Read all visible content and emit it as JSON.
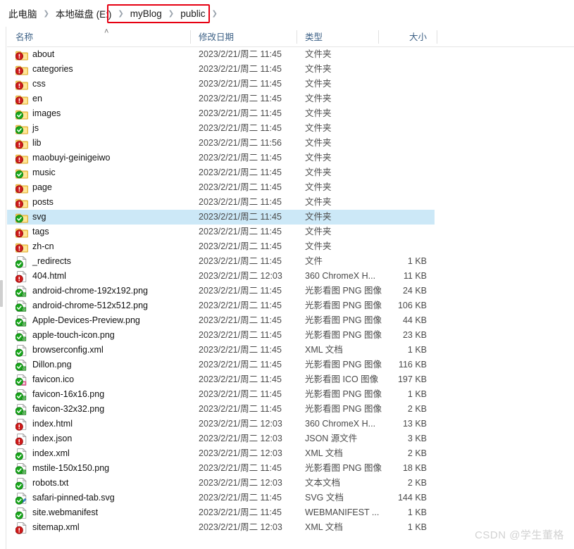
{
  "window": {
    "title": "public"
  },
  "breadcrumb": {
    "separator": "❯",
    "items": [
      {
        "label": "此电脑",
        "highlighted": false
      },
      {
        "label": "本地磁盘 (E:)",
        "highlighted": false
      },
      {
        "label": "myBlog",
        "highlighted": true
      },
      {
        "label": "public",
        "highlighted": true
      }
    ],
    "annotation_color": "#e60012"
  },
  "columns": {
    "name": "名称",
    "date": "修改日期",
    "type": "类型",
    "size": "大小",
    "sort_indicator": "˄",
    "sort_column": "名称",
    "sort_direction": "ascending"
  },
  "selection": {
    "selected_row_name": "svg",
    "highlight_color": "#cce8f7"
  },
  "rows": [
    {
      "name": "about",
      "date": "2023/2/21/周二 11:45",
      "type": "文件夹",
      "size": "",
      "icon": "folder-alert-icon",
      "selected": false
    },
    {
      "name": "categories",
      "date": "2023/2/21/周二 11:45",
      "type": "文件夹",
      "size": "",
      "icon": "folder-alert-icon",
      "selected": false
    },
    {
      "name": "css",
      "date": "2023/2/21/周二 11:45",
      "type": "文件夹",
      "size": "",
      "icon": "folder-alert-icon",
      "selected": false
    },
    {
      "name": "en",
      "date": "2023/2/21/周二 11:45",
      "type": "文件夹",
      "size": "",
      "icon": "folder-alert-icon",
      "selected": false
    },
    {
      "name": "images",
      "date": "2023/2/21/周二 11:45",
      "type": "文件夹",
      "size": "",
      "icon": "folder-synced-icon",
      "selected": false
    },
    {
      "name": "js",
      "date": "2023/2/21/周二 11:45",
      "type": "文件夹",
      "size": "",
      "icon": "folder-synced-icon",
      "selected": false
    },
    {
      "name": "lib",
      "date": "2023/2/21/周二 11:56",
      "type": "文件夹",
      "size": "",
      "icon": "folder-alert-icon",
      "selected": false
    },
    {
      "name": "maobuyi-geinigeiwo",
      "date": "2023/2/21/周二 11:45",
      "type": "文件夹",
      "size": "",
      "icon": "folder-alert-icon",
      "selected": false
    },
    {
      "name": "music",
      "date": "2023/2/21/周二 11:45",
      "type": "文件夹",
      "size": "",
      "icon": "folder-synced-icon",
      "selected": false
    },
    {
      "name": "page",
      "date": "2023/2/21/周二 11:45",
      "type": "文件夹",
      "size": "",
      "icon": "folder-alert-icon",
      "selected": false
    },
    {
      "name": "posts",
      "date": "2023/2/21/周二 11:45",
      "type": "文件夹",
      "size": "",
      "icon": "folder-alert-icon",
      "selected": false
    },
    {
      "name": "svg",
      "date": "2023/2/21/周二 11:45",
      "type": "文件夹",
      "size": "",
      "icon": "folder-synced-icon",
      "selected": true
    },
    {
      "name": "tags",
      "date": "2023/2/21/周二 11:45",
      "type": "文件夹",
      "size": "",
      "icon": "folder-alert-icon",
      "selected": false
    },
    {
      "name": "zh-cn",
      "date": "2023/2/21/周二 11:45",
      "type": "文件夹",
      "size": "",
      "icon": "folder-alert-icon",
      "selected": false
    },
    {
      "name": "_redirects",
      "date": "2023/2/21/周二 11:45",
      "type": "文件",
      "size": "1 KB",
      "icon": "file-synced-icon",
      "selected": false
    },
    {
      "name": "404.html",
      "date": "2023/2/21/周二 12:03",
      "type": "360 ChromeX H...",
      "size": "11 KB",
      "icon": "file-alert-icon",
      "selected": false
    },
    {
      "name": "android-chrome-192x192.png",
      "date": "2023/2/21/周二 11:45",
      "type": "光影看图 PNG 图像",
      "size": "24 KB",
      "icon": "file-png-icon",
      "selected": false
    },
    {
      "name": "android-chrome-512x512.png",
      "date": "2023/2/21/周二 11:45",
      "type": "光影看图 PNG 图像",
      "size": "106 KB",
      "icon": "file-png-icon",
      "selected": false
    },
    {
      "name": "Apple-Devices-Preview.png",
      "date": "2023/2/21/周二 11:45",
      "type": "光影看图 PNG 图像",
      "size": "44 KB",
      "icon": "file-png-icon",
      "selected": false
    },
    {
      "name": "apple-touch-icon.png",
      "date": "2023/2/21/周二 11:45",
      "type": "光影看图 PNG 图像",
      "size": "23 KB",
      "icon": "file-png-icon",
      "selected": false
    },
    {
      "name": "browserconfig.xml",
      "date": "2023/2/21/周二 11:45",
      "type": "XML 文档",
      "size": "1 KB",
      "icon": "file-synced-icon",
      "selected": false
    },
    {
      "name": "Dillon.png",
      "date": "2023/2/21/周二 11:45",
      "type": "光影看图 PNG 图像",
      "size": "116 KB",
      "icon": "file-png-icon",
      "selected": false
    },
    {
      "name": "favicon.ico",
      "date": "2023/2/21/周二 11:45",
      "type": "光影看图 ICO 图像",
      "size": "197 KB",
      "icon": "file-ico-icon",
      "selected": false
    },
    {
      "name": "favicon-16x16.png",
      "date": "2023/2/21/周二 11:45",
      "type": "光影看图 PNG 图像",
      "size": "1 KB",
      "icon": "file-png-icon",
      "selected": false
    },
    {
      "name": "favicon-32x32.png",
      "date": "2023/2/21/周二 11:45",
      "type": "光影看图 PNG 图像",
      "size": "2 KB",
      "icon": "file-png-icon",
      "selected": false
    },
    {
      "name": "index.html",
      "date": "2023/2/21/周二 12:03",
      "type": "360 ChromeX H...",
      "size": "13 KB",
      "icon": "file-alert-icon",
      "selected": false
    },
    {
      "name": "index.json",
      "date": "2023/2/21/周二 12:03",
      "type": "JSON 源文件",
      "size": "3 KB",
      "icon": "file-alert-icon",
      "selected": false
    },
    {
      "name": "index.xml",
      "date": "2023/2/21/周二 12:03",
      "type": "XML 文档",
      "size": "2 KB",
      "icon": "file-synced-icon",
      "selected": false
    },
    {
      "name": "mstile-150x150.png",
      "date": "2023/2/21/周二 11:45",
      "type": "光影看图 PNG 图像",
      "size": "18 KB",
      "icon": "file-png-icon",
      "selected": false
    },
    {
      "name": "robots.txt",
      "date": "2023/2/21/周二 12:03",
      "type": "文本文档",
      "size": "2 KB",
      "icon": "file-txt-icon",
      "selected": false
    },
    {
      "name": "safari-pinned-tab.svg",
      "date": "2023/2/21/周二 11:45",
      "type": "SVG 文档",
      "size": "144 KB",
      "icon": "file-svg-icon",
      "selected": false
    },
    {
      "name": "site.webmanifest",
      "date": "2023/2/21/周二 11:45",
      "type": "WEBMANIFEST ...",
      "size": "1 KB",
      "icon": "file-synced-icon",
      "selected": false
    },
    {
      "name": "sitemap.xml",
      "date": "2023/2/21/周二 12:03",
      "type": "XML 文档",
      "size": "1 KB",
      "icon": "file-alert-icon",
      "selected": false
    }
  ],
  "watermark": {
    "text": "CSDN @学生董格"
  }
}
